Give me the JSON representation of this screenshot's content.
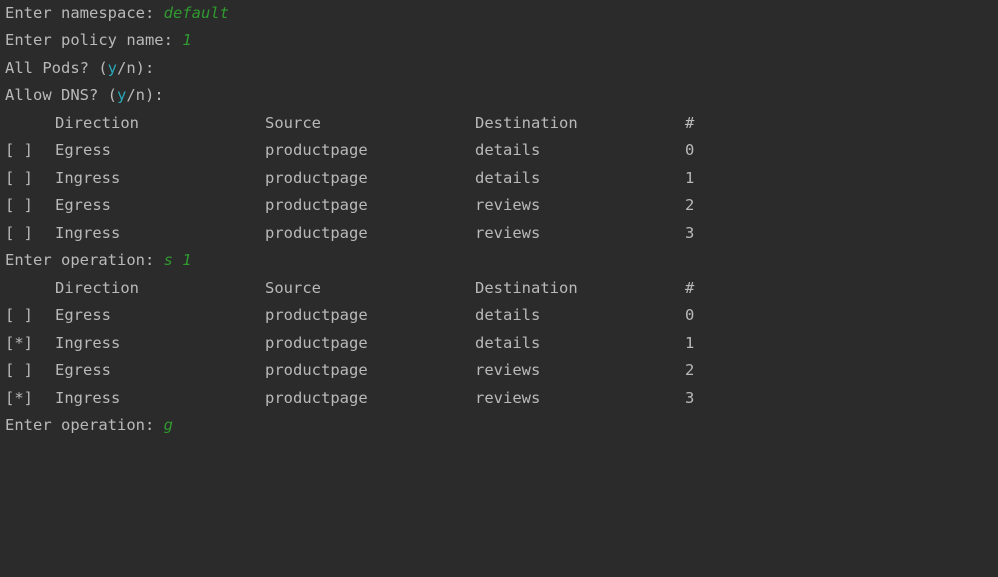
{
  "prompts": {
    "namespace_label": "Enter namespace: ",
    "namespace_value": "default",
    "policy_label": "Enter policy name: ",
    "policy_value": "1",
    "all_pods_label_prefix": "All Pods? (",
    "all_pods_yes": "y",
    "all_pods_label_suffix": "/n):",
    "allow_dns_label_prefix": "Allow DNS? (",
    "allow_dns_yes": "y",
    "allow_dns_label_suffix": "/n):"
  },
  "headers": [
    "Direction",
    "Source",
    "Destination",
    "#"
  ],
  "table1": {
    "rows": [
      {
        "check": "[ ]",
        "direction": "Egress",
        "source": "productpage",
        "destination": "details",
        "index": "0"
      },
      {
        "check": "[ ]",
        "direction": "Ingress",
        "source": "productpage",
        "destination": "details",
        "index": "1"
      },
      {
        "check": "[ ]",
        "direction": "Egress",
        "source": "productpage",
        "destination": "reviews",
        "index": "2"
      },
      {
        "check": "[ ]",
        "direction": "Ingress",
        "source": "productpage",
        "destination": "reviews",
        "index": "3"
      }
    ]
  },
  "op1": {
    "label": "Enter operation: ",
    "value": "s 1"
  },
  "table2": {
    "rows": [
      {
        "check": "[ ]",
        "direction": "Egress",
        "source": "productpage",
        "destination": "details",
        "index": "0"
      },
      {
        "check": "[*]",
        "direction": "Ingress",
        "source": "productpage",
        "destination": "details",
        "index": "1"
      },
      {
        "check": "[ ]",
        "direction": "Egress",
        "source": "productpage",
        "destination": "reviews",
        "index": "2"
      },
      {
        "check": "[*]",
        "direction": "Ingress",
        "source": "productpage",
        "destination": "reviews",
        "index": "3"
      }
    ]
  },
  "op2": {
    "label": "Enter operation: ",
    "value": "g"
  },
  "colors": {
    "background": "#2b2b2b",
    "text": "#b9b9b9",
    "input": "#2f9a2f",
    "accent": "#2aa7b8"
  }
}
